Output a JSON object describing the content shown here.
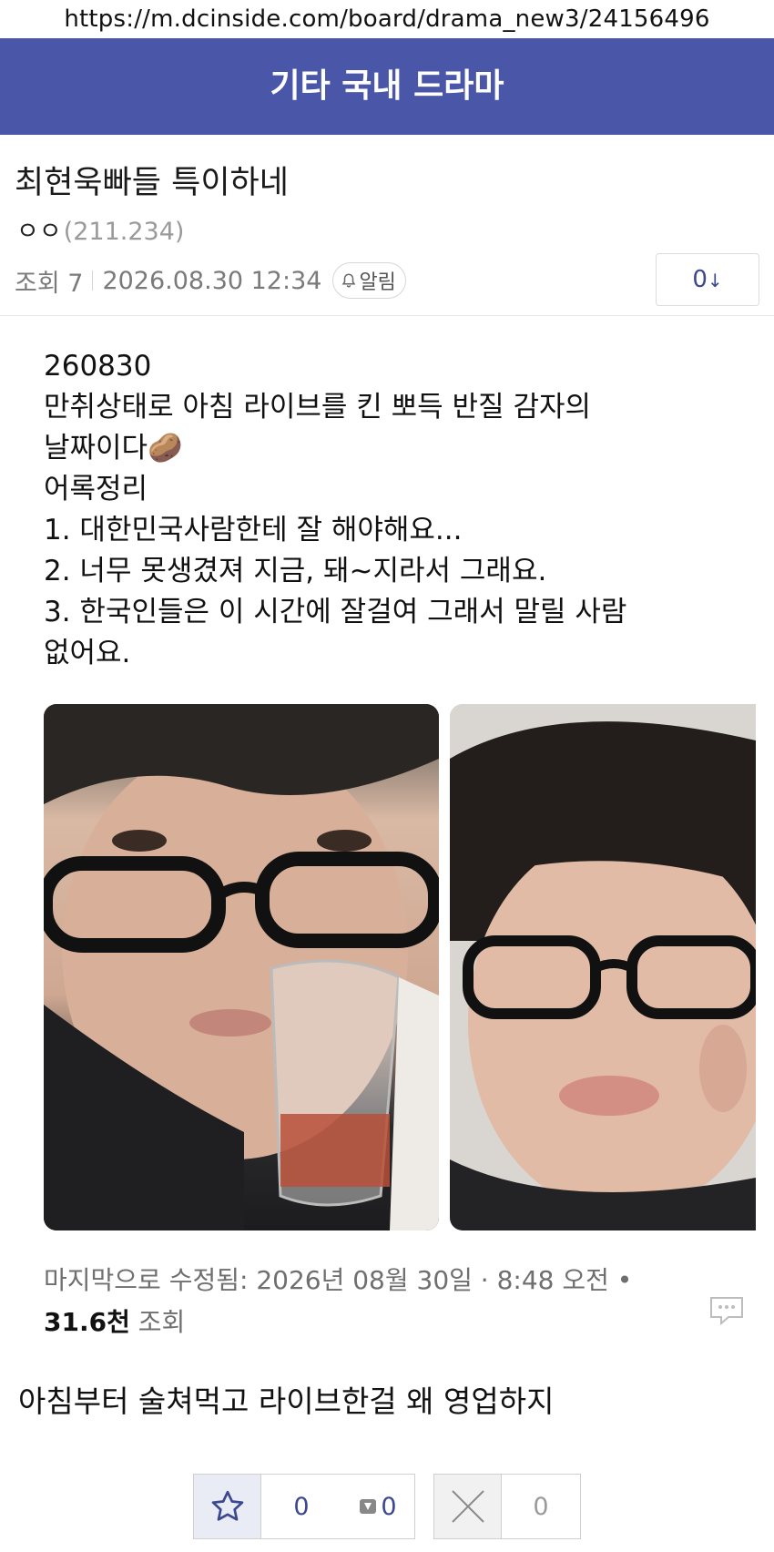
{
  "browser": {
    "url": "https://m.dcinside.com/board/drama_new3/24156496"
  },
  "gallery": {
    "name": "기타 국내 드라마"
  },
  "post": {
    "title": "최현욱빠들 특이하네",
    "author": "ㅇㅇ",
    "ip": "(211.234)",
    "views_label": "조회 7",
    "datetime": "2026.08.30 12:34",
    "alarm_label": "알림",
    "comment_count": "0",
    "body": "아침부터 술쳐먹고 라이브한걸 왜 영업하지"
  },
  "embed": {
    "lines": [
      "260830",
      "만취상태로 아침 라이브를 킨 뽀득 반질 감자의",
      "날짜이다🥔",
      "어록정리",
      "1. 대한민국사람한테 잘 해야해요...",
      "2. 너무 못생겼져 지금, 돼~지라서 그래요.",
      "3. 한국인들은 이 시간에 잘걸여 그래서 말릴 사람",
      "없어요."
    ],
    "edited": "마지막으로 수정됨: 2026년 08월 30일 · 8:48 오전 •",
    "views_num": "31.6천",
    "views_suffix": " 조회"
  },
  "recommend": {
    "count": "0",
    "fix_count": "0"
  },
  "nonrecommend": {
    "count": "0"
  },
  "colors": {
    "header": "#4a57a9",
    "accent": "#3b4890"
  },
  "icons": [
    "bell-icon",
    "comment-arrow-icon",
    "chat-bubble-icon",
    "star-icon",
    "fix-icon",
    "x-icon"
  ]
}
